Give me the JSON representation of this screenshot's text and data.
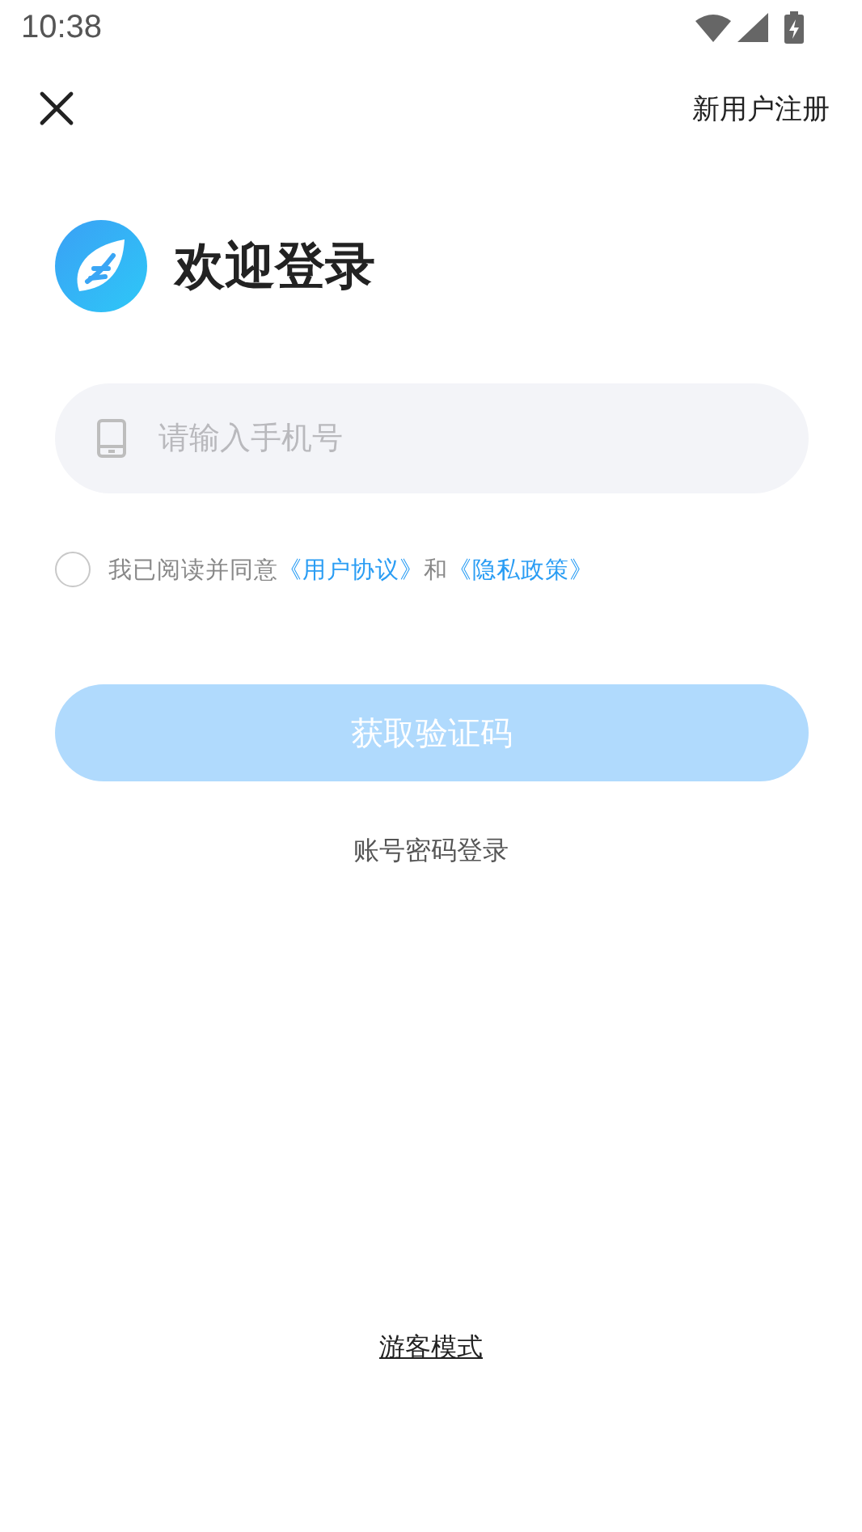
{
  "status_bar": {
    "time": "10:38"
  },
  "header": {
    "register_link": "新用户注册"
  },
  "welcome": {
    "title": "欢迎登录"
  },
  "phone_field": {
    "placeholder": "请输入手机号"
  },
  "agreement": {
    "checked": false,
    "prefix": "我已阅读并同意",
    "user_agreement": "《用户协议》",
    "joiner": "和",
    "privacy_policy": "《隐私政策》"
  },
  "code_button": {
    "label": "获取验证码",
    "disabled": true
  },
  "password_login": "账号密码登录",
  "guest_mode": "游客模式"
}
